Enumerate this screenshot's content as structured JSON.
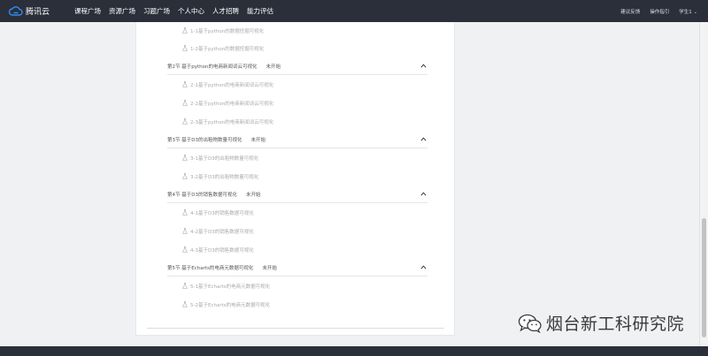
{
  "header": {
    "logo_text": "腾讯云",
    "nav": [
      "课程广场",
      "资源广场",
      "习题广场",
      "个人中心",
      "人才招聘",
      "能力评估"
    ],
    "right": {
      "link1": "建议反馈",
      "link2": "操作指引",
      "user": "学生1"
    }
  },
  "top_lessons": [
    "1-1基于python的数据挖掘可视化",
    "1-2基于python的数据挖掘可视化"
  ],
  "chapters": [
    {
      "title": "第2节 基于python的电商新闻词云可视化",
      "status": "未开始",
      "lessons": [
        "2-1基于python的电商新闻词云可视化",
        "2-2基于python的电商新闻词云可视化",
        "2-3基于python的电商新闻词云可视化"
      ]
    },
    {
      "title": "第3节 基于D3的出租物数量可视化",
      "status": "未开始",
      "lessons": [
        "3-1基于D3的出租物数量可视化",
        "3-2基于D3的出租物数量可视化"
      ]
    },
    {
      "title": "第4节 基于D3的销售数据可视化",
      "status": "未开始",
      "lessons": [
        "4-1基于D3的销售数据可视化",
        "4-2基于D3的销售数据可视化",
        "4-3基于D3的销售数据可视化"
      ]
    },
    {
      "title": "第5节 基于Echarts的电商元数据可视化",
      "status": "未开始",
      "lessons": [
        "5-1基于Echarts的电商元数据可视化",
        "5-2基于Echarts的电商元数据可视化"
      ]
    }
  ],
  "watermark": {
    "text": "烟台新工科研究院"
  },
  "colors": {
    "header_bg": "#2b2f3a",
    "logo_blue": "#2f8cf0",
    "muted_text": "#aaaaaa"
  },
  "icons": {
    "logo": "cloud-icon",
    "lesson": "flask-icon",
    "collapse": "chevron-up-icon",
    "watermark": "wechat-icon"
  }
}
